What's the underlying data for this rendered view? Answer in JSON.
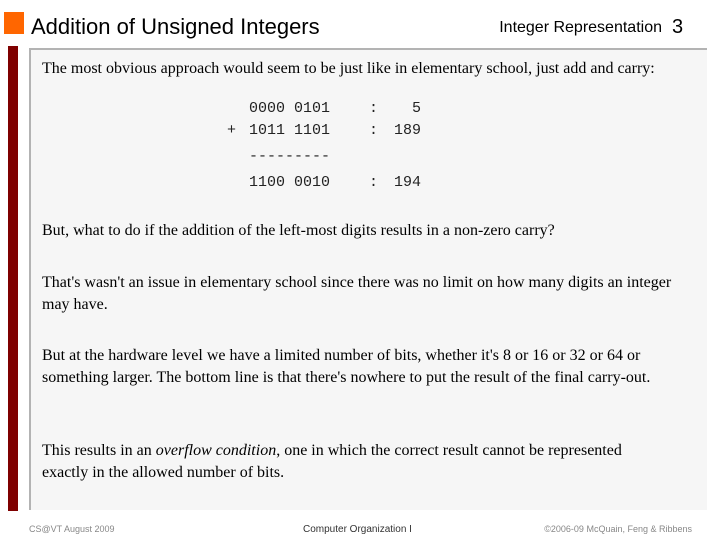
{
  "header": {
    "title": "Addition of Unsigned Integers",
    "section": "Integer Representation",
    "page_number": "3"
  },
  "colors": {
    "accent_square": "#ff6600",
    "accent_bar": "#7f0000",
    "content_background": "#f6f6f6",
    "content_border": "#b3b3b3"
  },
  "body": {
    "intro": "The most obvious approach would seem to be just like in elementary school, just add and carry:",
    "addition": {
      "rows": [
        {
          "operator": " ",
          "binary": "0000 0101",
          "sep": ":",
          "decimal": "  5"
        },
        {
          "operator": "+",
          "binary": "1011 1101",
          "sep": ":",
          "decimal": "189"
        }
      ],
      "rule": "---------",
      "result": {
        "binary": "1100 0010",
        "sep": ":",
        "decimal": "194"
      }
    },
    "question": "But, what to do if the addition of the left-most digits results in a non-zero carry?",
    "elementary": "That's wasn't an issue in elementary school since there was no limit on how many digits an integer may have.",
    "hardware": "But at the hardware level we have a limited number of bits, whether it's 8 or 16 or 32 or 64 or something larger.  The bottom line is that there's nowhere to put the result of the final carry-out.",
    "overflow": {
      "prefix": "This results in an ",
      "term": "overflow condition",
      "suffix": ", one in which the correct result cannot be represented exactly in the allowed number of bits."
    }
  },
  "footer": {
    "left": "CS@VT August 2009",
    "center": "Computer Organization I",
    "right": "©2006-09  McQuain, Feng & Ribbens"
  }
}
